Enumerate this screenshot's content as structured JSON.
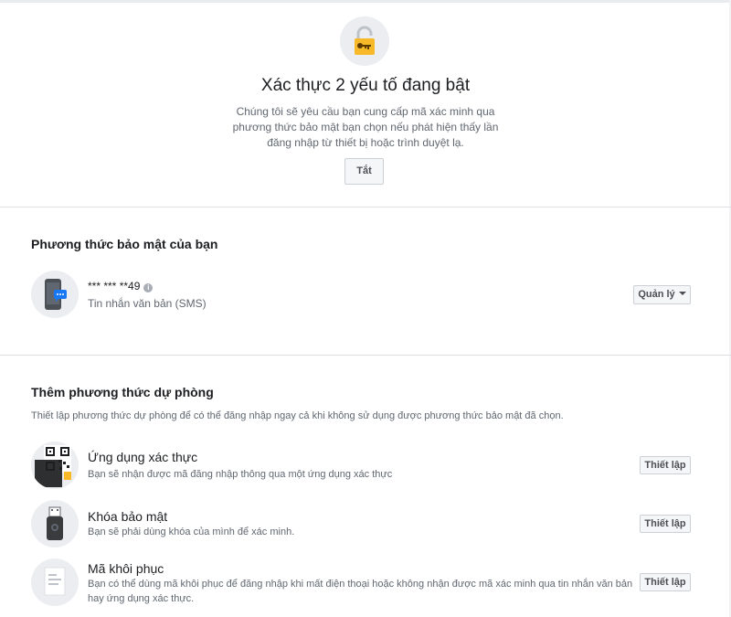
{
  "status": {
    "icon": "lock-key-icon",
    "title": "Xác thực 2 yếu tố đang bật",
    "description": "Chúng tôi sẽ yêu cầu bạn cung cấp mã xác minh qua phương thức bảo mật bạn chọn nếu phát hiện thấy lần đăng nhập từ thiết bị hoặc trình duyệt lạ.",
    "off_label": "Tắt"
  },
  "methods": {
    "title": "Phương thức bảo mật của bạn",
    "sms": {
      "icon": "sms-phone-icon",
      "phone": "*** *** **49",
      "type": "Tin nhắn văn bản (SMS)",
      "info_icon": "info-icon",
      "manage_label": "Quản lý"
    }
  },
  "backup": {
    "title": "Thêm phương thức dự phòng",
    "description": "Thiết lập phương thức dự phòng để có thể đăng nhập ngay cả khi không sử dụng được phương thức bảo mật đã chọn.",
    "options": [
      {
        "icon": "qr-phone-icon",
        "title": "Ứng dụng xác thực",
        "description": "Bạn sẽ nhận được mã đăng nhập thông qua một ứng dụng xác thực",
        "button": "Thiết lập"
      },
      {
        "icon": "usb-key-icon",
        "title": "Khóa bảo mật",
        "description": "Bạn sẽ phải dùng khóa của mình để xác minh.",
        "button": "Thiết lập"
      },
      {
        "icon": "document-icon",
        "title": "Mã khôi phục",
        "description": "Bạn có thể dùng mã khôi phục để đăng nhập khi mất điện thoại hoặc không nhận được mã xác minh qua tin nhắn văn bản hay ứng dụng xác thực.",
        "button": "Thiết lập"
      }
    ]
  },
  "colors": {
    "divider": "#dddfe2",
    "icon_bg": "#ebedf0",
    "lock_yellow": "#f7b928",
    "sms_blue": "#1877f2"
  }
}
